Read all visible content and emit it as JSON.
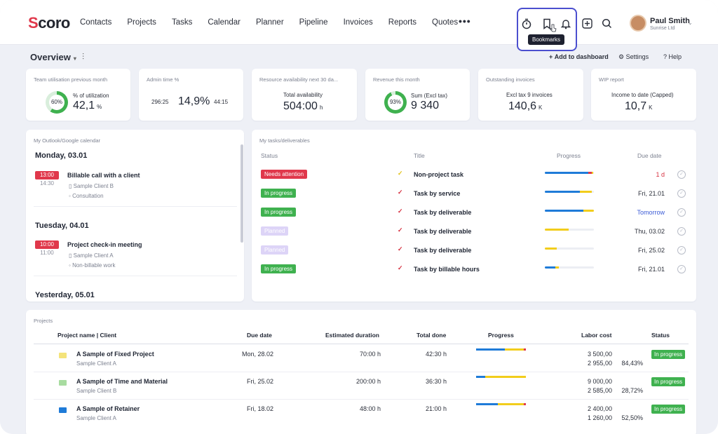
{
  "brand": {
    "logo_prefix": "S",
    "logo_rest": "coro"
  },
  "nav": {
    "items": [
      "Contacts",
      "Projects",
      "Tasks",
      "Calendar",
      "Planner",
      "Pipeline",
      "Invoices",
      "Reports",
      "Quotes"
    ],
    "more": "•••"
  },
  "toolbar": {
    "tooltip": "Bookmarks"
  },
  "user": {
    "name": "Paul Smith",
    "company": "Sunrise Ltd"
  },
  "overview": {
    "title": "Overview",
    "add_dashboard": "Add to dashboard",
    "settings": "Settings",
    "help": "Help"
  },
  "kpis": [
    {
      "title": "Team utilisation previous month",
      "donut": "60%",
      "label": "% of utilization",
      "value": "42,1",
      "unit": "%"
    },
    {
      "title": "Admin time %",
      "left": "296:25",
      "value": "14,9%",
      "right": "44:15"
    },
    {
      "title": "Resource availability next 30 da...",
      "label": "Total availability",
      "value": "504:00",
      "unit": "h"
    },
    {
      "title": "Revenue this month",
      "donut": "93%",
      "label": "Sum (Excl tax)",
      "value": "9 340"
    },
    {
      "title": "Outstanding invoices",
      "label": "Excl tax 9 invoices",
      "value": "140,6",
      "unit": "K"
    },
    {
      "title": "WIP report",
      "label": "Income to date (Capped)",
      "value": "10,7",
      "unit": "K"
    }
  ],
  "calendar": {
    "title": "My Outlook/Google calendar",
    "days": [
      {
        "day": "Monday, 03.01",
        "start": "13:00",
        "end": "14:30",
        "event": "Billable call with a client",
        "client": "Sample Client B",
        "type": "Consultation"
      },
      {
        "day": "Tuesday, 04.01",
        "start": "10:00",
        "end": "11:00",
        "event": "Project check-in meeting",
        "client": "Sample Client A",
        "type": "Non-billable work"
      },
      {
        "day": "Yesterday, 05.01"
      }
    ]
  },
  "tasks": {
    "title": "My tasks/deliverables",
    "headers": {
      "status": "Status",
      "title": "Title",
      "progress": "Progress",
      "due": "Due date"
    },
    "rows": [
      {
        "status": "Needs attention",
        "status_color": "#e0384b",
        "title": "Non-project task",
        "check_color": "#e2c21a",
        "progress": [
          0.88,
          0.1
        ],
        "due": "1 d",
        "due_color": "#d62f3f"
      },
      {
        "status": "In progress",
        "status_color": "#3fb14f",
        "title": "Task by service",
        "check_color": "#d62f3f",
        "progress": [
          0.72,
          0.2
        ],
        "due": "Fri, 21.01",
        "due_color": "#2b2f3a"
      },
      {
        "status": "In progress",
        "status_color": "#3fb14f",
        "title": "Task by deliverable",
        "check_color": "#d62f3f",
        "progress": [
          0.78,
          0.22
        ],
        "due": "Tomorrow",
        "due_color": "#3b5bd6"
      },
      {
        "status": "Planned",
        "status_color": "#ddd4f7",
        "title": "Task by deliverable",
        "check_color": "#d62f3f",
        "progress": [
          0,
          0.48
        ],
        "due": "Thu, 03.02",
        "due_color": "#2b2f3a"
      },
      {
        "status": "Planned",
        "status_color": "#ddd4f7",
        "title": "Task by deliverable",
        "check_color": "#d62f3f",
        "progress": [
          0,
          0.24
        ],
        "due": "Fri, 25.02",
        "due_color": "#2b2f3a"
      },
      {
        "status": "In progress",
        "status_color": "#3fb14f",
        "title": "Task by billable hours",
        "check_color": "#d62f3f",
        "progress": [
          0.22,
          0.06
        ],
        "due": "Fri, 21.01",
        "due_color": "#2b2f3a"
      }
    ]
  },
  "projects": {
    "title": "Projects",
    "headers": {
      "name": "Project name | Client",
      "due": "Due date",
      "est": "Estimated duration",
      "total": "Total done",
      "progress": "Progress",
      "labor": "Labor cost",
      "status": "Status"
    },
    "rows": [
      {
        "name": "A Sample of Fixed Project",
        "client": "Sample Client A",
        "icon_color": "#f4e37a",
        "due": "Mon, 28.02",
        "est": "70:00 h",
        "total": "42:30 h",
        "progress": [
          0.58,
          0.38
        ],
        "labor1": "3 500,00",
        "labor2": "2 955,00",
        "pct": "84,43%",
        "status": "In progress"
      },
      {
        "name": "A Sample of Time and Material",
        "client": "Sample Client B",
        "icon_color": "#a8dca0",
        "due": "Fri, 25.02",
        "est": "200:00 h",
        "total": "36:30 h",
        "progress": [
          0.18,
          0.82
        ],
        "labor1": "9 000,00",
        "labor2": "2 585,00",
        "pct": "28,72%",
        "status": "In progress"
      },
      {
        "name": "A Sample of Retainer",
        "client": "Sample Client A",
        "icon_color": "#1f7bd8",
        "due": "Fri, 18.02",
        "est": "48:00 h",
        "total": "21:00 h",
        "progress": [
          0.44,
          0.52
        ],
        "labor1": "2 400,00",
        "labor2": "1 260,00",
        "pct": "52,50%",
        "status": "In progress"
      }
    ]
  },
  "colors": {
    "accent": "#4b4fcf",
    "progress_blue": "#1f7bd8",
    "progress_yellow": "#f2cd1c",
    "progress_red": "#e0384b",
    "green": "#3fb14f"
  }
}
